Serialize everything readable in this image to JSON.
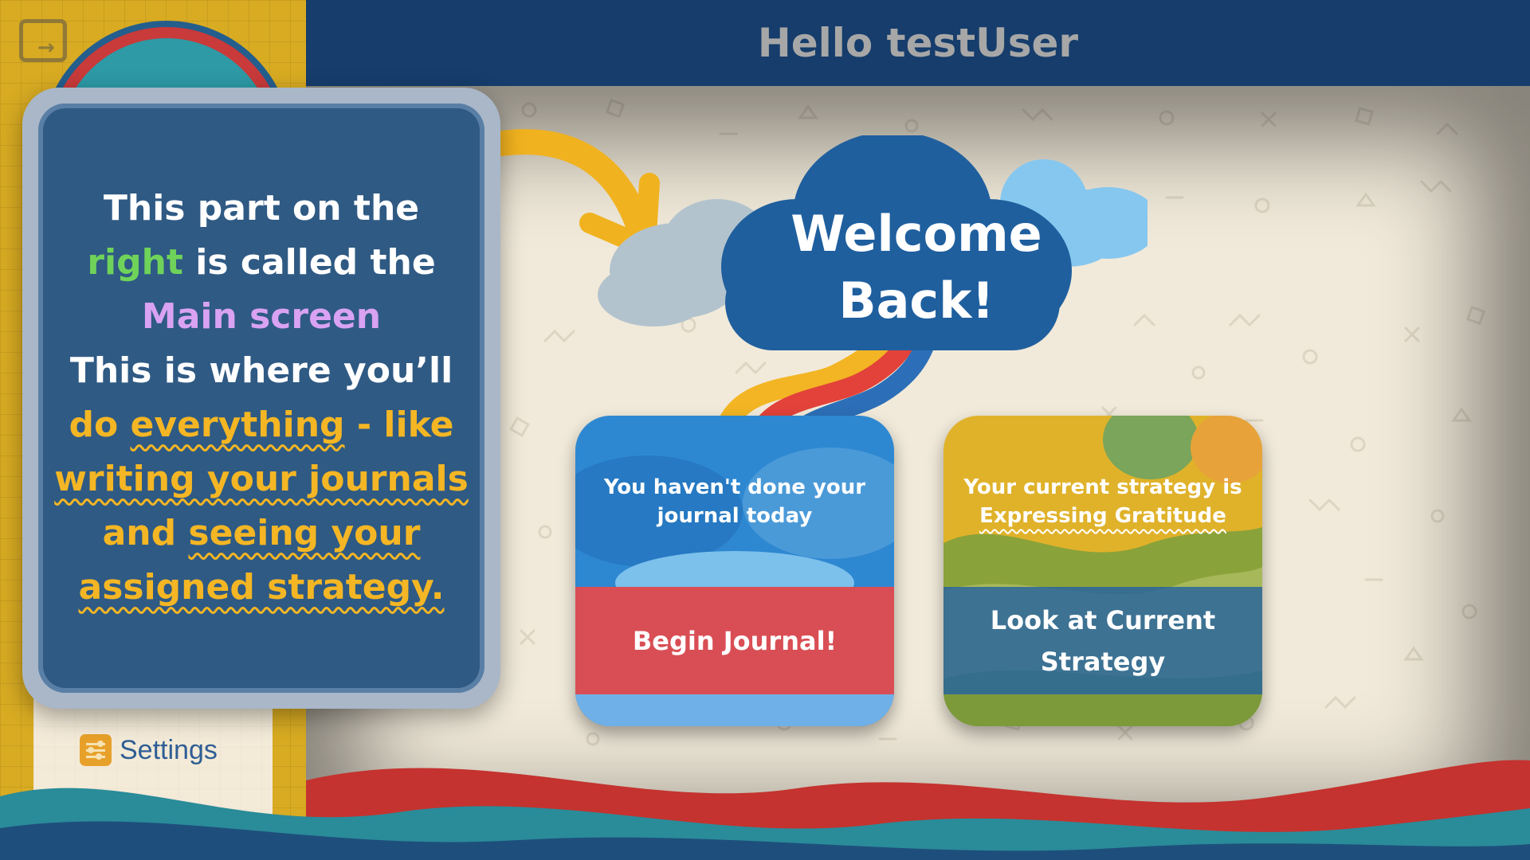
{
  "header": {
    "greeting": "Hello testUser"
  },
  "sidebar": {
    "settings_label": "Settings"
  },
  "tooltip": {
    "line1": "This part on the",
    "highlight_right": "right",
    "line2_rest": " is called the",
    "main_screen": "Main screen",
    "line4": "This is where you’ll",
    "do": "do ",
    "everything": "everything",
    "like": " - like",
    "writing_journals": "writing your journals",
    "and": "and ",
    "seeing_your": "seeing your",
    "assigned_strategy": "assigned strategy."
  },
  "welcome": {
    "line1": "Welcome",
    "line2": "Back!"
  },
  "journal_card": {
    "status_line1": "You haven't done your",
    "status_line2": "journal today",
    "button_label": "Begin Journal!"
  },
  "strategy_card": {
    "status_line1": "Your current strategy is",
    "strategy_name": "Expressing Gratitude",
    "button_line1": "Look at Current",
    "button_line2": "Strategy"
  },
  "colors": {
    "header_bg": "#163d6b",
    "sidebar_bg": "#d8ab22",
    "tooltip_bg": "#2f5a84",
    "accent_yellow": "#f4b624",
    "accent_green": "#6fd35a",
    "accent_purple": "#d9a2f2",
    "journal_button": "#d94e55"
  },
  "icons": [
    "logout-icon",
    "avatar-face",
    "settings-icon",
    "arrow-icon"
  ]
}
